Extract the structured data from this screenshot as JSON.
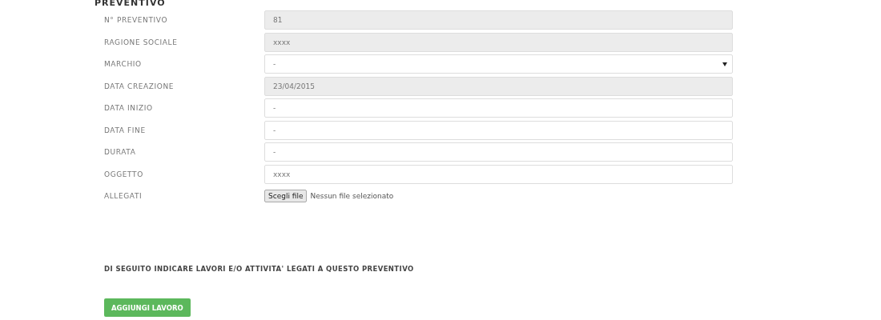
{
  "section_title": "PREVENTIVO",
  "fields": [
    {
      "label": "N° PREVENTIVO",
      "kind": "readonly",
      "value": "81"
    },
    {
      "label": "RAGIONE SOCIALE",
      "kind": "readonly",
      "value": "xxxx"
    },
    {
      "label": "MARCHIO",
      "kind": "select",
      "value": "-"
    },
    {
      "label": "DATA CREAZIONE",
      "kind": "readonly",
      "value": "23/04/2015"
    },
    {
      "label": "DATA INIZIO",
      "kind": "text",
      "value": "-"
    },
    {
      "label": "DATA FINE",
      "kind": "text",
      "value": "-"
    },
    {
      "label": "DURATA",
      "kind": "text",
      "value": "-"
    },
    {
      "label": "OGGETTO",
      "kind": "text",
      "value": "xxxx"
    },
    {
      "label": "ALLEGATI",
      "kind": "file",
      "button": "Scegli file",
      "value": "Nessun file selezionato"
    }
  ],
  "works_heading": "DI SEGUITO INDICARE LAVORI E/O ATTIVITA' LEGATI A QUESTO PREVENTIVO",
  "add_button": "AGGIUNGI LAVORO"
}
